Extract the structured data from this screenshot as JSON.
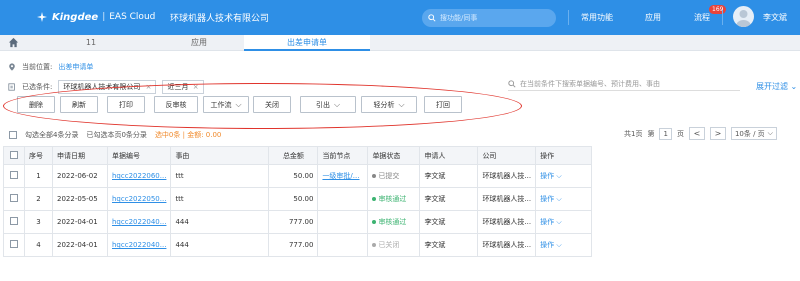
{
  "header": {
    "brand": "Kingdee",
    "product": "EAS Cloud",
    "company": "环球机器人技术有限公司",
    "search_placeholder": "搜功能/同事",
    "links": [
      "常用功能",
      "应用",
      "流程"
    ],
    "badge": "169",
    "user": "李文斌"
  },
  "tabs": [
    {
      "label": "11",
      "active": false
    },
    {
      "label": "应用",
      "active": false
    },
    {
      "label": "出差申请单",
      "active": true
    }
  ],
  "location": {
    "label": "当前位置:",
    "value": "出差申请单"
  },
  "filter": {
    "label": "已选条件:",
    "company": "环球机器人技术有限公司",
    "period": "近三月",
    "search_placeholder": "在当前条件下搜索单据编号、预计费用、事由",
    "expand": "展开过滤"
  },
  "toolbar": {
    "buttons": [
      {
        "label": "删除",
        "dropdown": false
      },
      {
        "label": "刷新",
        "dropdown": false
      },
      {
        "label": "打印",
        "dropdown": false
      },
      {
        "label": "反审核",
        "dropdown": false
      },
      {
        "label": "工作流",
        "dropdown": true
      },
      {
        "label": "关闭",
        "dropdown": false
      },
      {
        "label": "引出",
        "dropdown": true
      },
      {
        "label": "轻分析",
        "dropdown": true
      },
      {
        "label": "打回",
        "dropdown": false
      }
    ]
  },
  "summary": {
    "all": "勾选全部4条分录",
    "page": "已勾选本页0条分录",
    "selected": "选中0条 | 金额: 0.00"
  },
  "pager": {
    "total": "共1页",
    "page_label": "第",
    "page": "1",
    "page_suffix": "页",
    "prev": "<",
    "next": ">",
    "size": "10条 / 页"
  },
  "table": {
    "columns": [
      "序号",
      "申请日期",
      "单据编号",
      "事由",
      "总金额",
      "当前节点",
      "单据状态",
      "申请人",
      "公司",
      "操作"
    ],
    "rows": [
      {
        "no": "1",
        "date": "2022-06-02",
        "code": "hqcc2022060...",
        "reason": "ttt",
        "amount": "50.00",
        "node": "一级审批/...",
        "status": "已提交",
        "status_color": "#888888",
        "applicant": "李文斌",
        "company": "环球机器人技...",
        "op": "操作"
      },
      {
        "no": "2",
        "date": "2022-05-05",
        "code": "hqcc2022050...",
        "reason": "ttt",
        "amount": "50.00",
        "node": "",
        "status": "审核通过",
        "status_color": "#3cb371",
        "applicant": "李文斌",
        "company": "环球机器人技...",
        "op": "操作"
      },
      {
        "no": "3",
        "date": "2022-04-01",
        "code": "hqcc2022040...",
        "reason": "444",
        "amount": "777.00",
        "node": "",
        "status": "审核通过",
        "status_color": "#3cb371",
        "applicant": "李文斌",
        "company": "环球机器人技...",
        "op": "操作"
      },
      {
        "no": "4",
        "date": "2022-04-01",
        "code": "hqcc2022040...",
        "reason": "444",
        "amount": "777.00",
        "node": "",
        "status": "已关闭",
        "status_color": "#aaaaaa",
        "applicant": "李文斌",
        "company": "环球机器人技...",
        "op": "操作"
      }
    ]
  },
  "colors": {
    "primary": "#2e8fe6",
    "annotation": "#e0342c"
  }
}
